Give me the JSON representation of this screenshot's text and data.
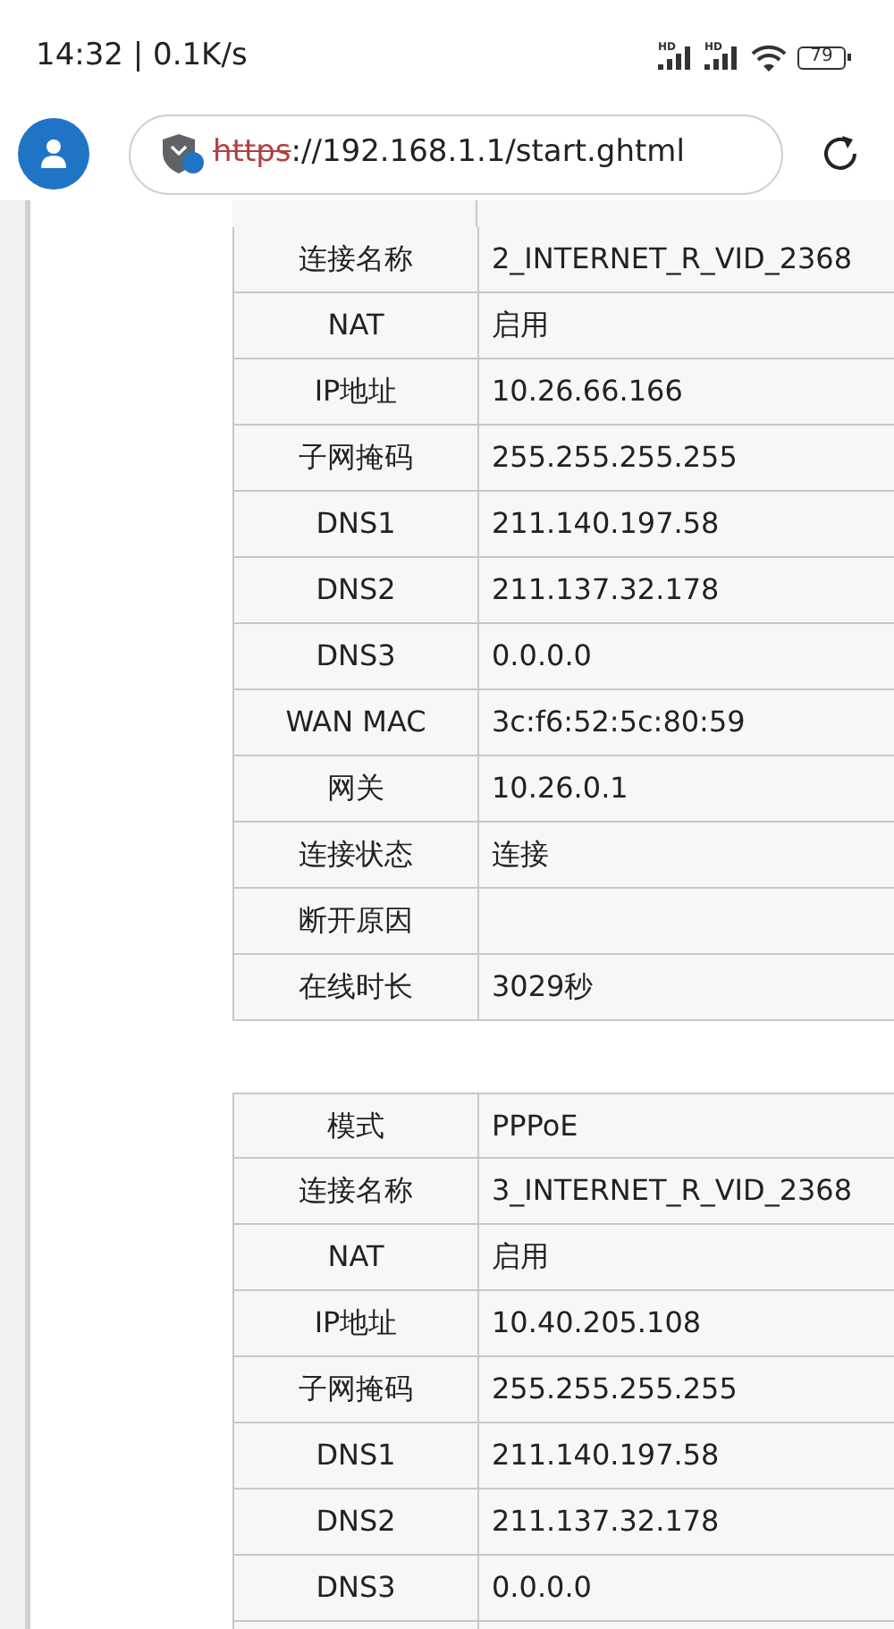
{
  "status_bar": {
    "time_speed": "14:32 | 0.1K/s",
    "signal_labels": [
      "HD",
      "HD"
    ],
    "battery": "79"
  },
  "address_bar": {
    "scheme": "https",
    "scheme_struck": true,
    "rest": "://192.168.1.1/start.ghtml"
  },
  "tables": [
    {
      "rows": [
        {
          "label": "连接名称",
          "value": "2_INTERNET_R_VID_2368"
        },
        {
          "label": "NAT",
          "value": "启用"
        },
        {
          "label": "IP地址",
          "value": "10.26.66.166"
        },
        {
          "label": "子网掩码",
          "value": "255.255.255.255"
        },
        {
          "label": "DNS1",
          "value": "211.140.197.58"
        },
        {
          "label": "DNS2",
          "value": "211.137.32.178"
        },
        {
          "label": "DNS3",
          "value": "0.0.0.0"
        },
        {
          "label": "WAN MAC",
          "value": "3c:f6:52:5c:80:59"
        },
        {
          "label": "网关",
          "value": "10.26.0.1"
        },
        {
          "label": "连接状态",
          "value": "连接"
        },
        {
          "label": "断开原因"
        },
        {
          "label": "在线时长",
          "value": "3029秒"
        }
      ]
    },
    {
      "rows": [
        {
          "label": "模式",
          "value": "PPPoE"
        },
        {
          "label": "连接名称",
          "value": "3_INTERNET_R_VID_2368"
        },
        {
          "label": "NAT",
          "value": "启用"
        },
        {
          "label": "IP地址",
          "value": "10.40.205.108"
        },
        {
          "label": "子网掩码",
          "value": "255.255.255.255"
        },
        {
          "label": "DNS1",
          "value": "211.140.197.58"
        },
        {
          "label": "DNS2",
          "value": "211.137.32.178"
        },
        {
          "label": "DNS3",
          "value": "0.0.0.0"
        }
      ]
    }
  ]
}
